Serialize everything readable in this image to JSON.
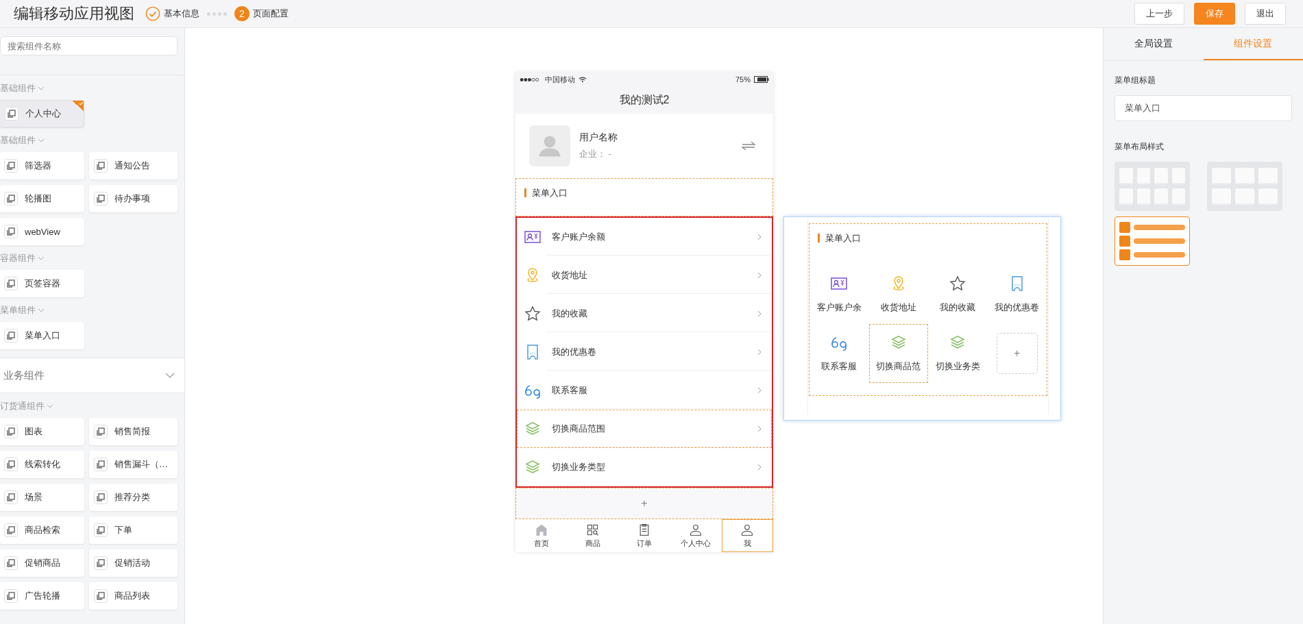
{
  "header": {
    "title": "编辑移动应用视图",
    "steps": [
      {
        "label": "基本信息",
        "kind": "done"
      },
      {
        "number": "2",
        "label": "页面配置",
        "kind": "current"
      }
    ],
    "buttons": [
      {
        "label": "上一步",
        "primary": false
      },
      {
        "label": "保存",
        "primary": true
      },
      {
        "label": "退出",
        "primary": false
      }
    ]
  },
  "sidebar": {
    "search": {
      "placeholder": "搜索组件名称"
    },
    "sections": [
      {
        "title": "基础组件",
        "items": [
          {
            "label": "个人中心",
            "selected": true
          }
        ]
      },
      {
        "title": "基础组件",
        "items": [
          {
            "label": "筛选器",
            "selected": false
          },
          {
            "label": "通知公告",
            "selected": false
          },
          {
            "label": "轮播图",
            "selected": false
          },
          {
            "label": "待办事项",
            "selected": false
          },
          {
            "label": "webView",
            "selected": false
          }
        ]
      },
      {
        "title": "容器组件",
        "items": [
          {
            "label": "页签容器",
            "selected": false
          }
        ]
      },
      {
        "title": "菜单组件",
        "items": [
          {
            "label": "菜单入口",
            "selected": false
          }
        ]
      }
    ],
    "group": {
      "title": "业务组件",
      "expanded": true
    },
    "group_sections": [
      {
        "title": "订货通组件",
        "items": [
          {
            "label": "图表",
            "selected": false
          },
          {
            "label": "销售简报",
            "selected": false
          },
          {
            "label": "线索转化",
            "selected": false
          },
          {
            "label": "销售漏斗（…",
            "selected": false
          },
          {
            "label": "场景",
            "selected": false
          },
          {
            "label": "推荐分类",
            "selected": false
          },
          {
            "label": "商品检索",
            "selected": false
          },
          {
            "label": "下单",
            "selected": false
          },
          {
            "label": "促销商品",
            "selected": false
          },
          {
            "label": "促销活动",
            "selected": false
          },
          {
            "label": "广告轮播",
            "selected": false
          },
          {
            "label": "商品列表",
            "selected": false
          }
        ]
      }
    ]
  },
  "phone": {
    "status_bar": {
      "carrier": "中国移动",
      "battery": "75%"
    },
    "title": "我的测试2",
    "profile": {
      "name": "用户名称",
      "company": "企业： -"
    },
    "menu": {
      "title": "菜单入口",
      "highlighted": true,
      "items": [
        {
          "label": "客户账户余额",
          "selected": false
        },
        {
          "label": "收货地址",
          "selected": false
        },
        {
          "label": "我的收藏",
          "selected": false
        },
        {
          "label": "我的优惠卷",
          "selected": false
        },
        {
          "label": "联系客服",
          "selected": false
        },
        {
          "label": "切换商品范围",
          "selected": true
        },
        {
          "label": "切换业务类型",
          "selected": false
        }
      ]
    },
    "add_label": "+",
    "tab_bar": [
      {
        "label": "首页",
        "selected": false
      },
      {
        "label": "商品",
        "selected": false
      },
      {
        "label": "订单",
        "selected": false
      },
      {
        "label": "个人中心",
        "selected": false
      },
      {
        "label": "我",
        "selected": true
      }
    ]
  },
  "preview": {
    "title": "菜单入口",
    "items": [
      {
        "label": "客户账户余",
        "selected": false
      },
      {
        "label": "收货地址",
        "selected": false
      },
      {
        "label": "我的收藏",
        "selected": false
      },
      {
        "label": "我的优惠卷",
        "selected": false
      },
      {
        "label": "联系客服",
        "selected": false
      },
      {
        "label": "切换商品范",
        "selected": true
      },
      {
        "label": "切换业务类",
        "selected": false
      }
    ],
    "add_label": "+"
  },
  "settings": {
    "tabs": [
      {
        "label": "全局设置",
        "selected": false
      },
      {
        "label": "组件设置",
        "selected": true
      }
    ],
    "title_field": {
      "label": "菜单组标题",
      "value": "菜单入口"
    },
    "layout": {
      "label": "菜单布局样式",
      "options": [
        {
          "kind": "grid4",
          "selected": false
        },
        {
          "kind": "grid3",
          "selected": false
        },
        {
          "kind": "list",
          "selected": true
        }
      ]
    }
  }
}
